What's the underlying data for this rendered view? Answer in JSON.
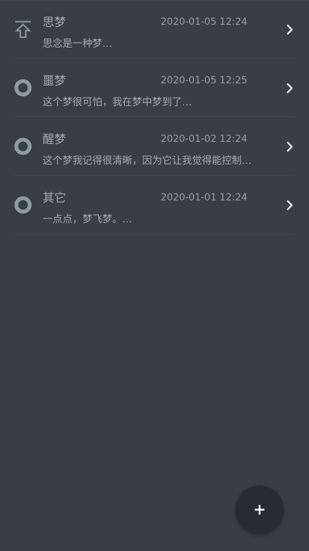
{
  "colors": {
    "background": "#393d45",
    "fab": "#272b32",
    "icon": "#8e9ba3",
    "text": "#a4acb2"
  },
  "dreams": [
    {
      "title": "思梦",
      "time": "2020-01-05 12:24",
      "preview": "思念是一种梦…",
      "icon": "pin-to-top-icon",
      "pinned": true
    },
    {
      "title": "噩梦",
      "time": "2020-01-05 12:25",
      "preview": "这个梦很可怕，我在梦中梦到了…",
      "icon": "ring-dot-icon",
      "pinned": false
    },
    {
      "title": "醒梦",
      "time": "2020-01-02 12:24",
      "preview": "这个梦我记得很清晰，因为它让我觉得能控制…",
      "icon": "ring-dot-icon",
      "pinned": false
    },
    {
      "title": "其它",
      "time": "2020-01-01 12:24",
      "preview": "一点点，梦飞梦。…",
      "icon": "ring-dot-icon",
      "pinned": false
    }
  ],
  "fab": {
    "icon": "plus-icon"
  }
}
